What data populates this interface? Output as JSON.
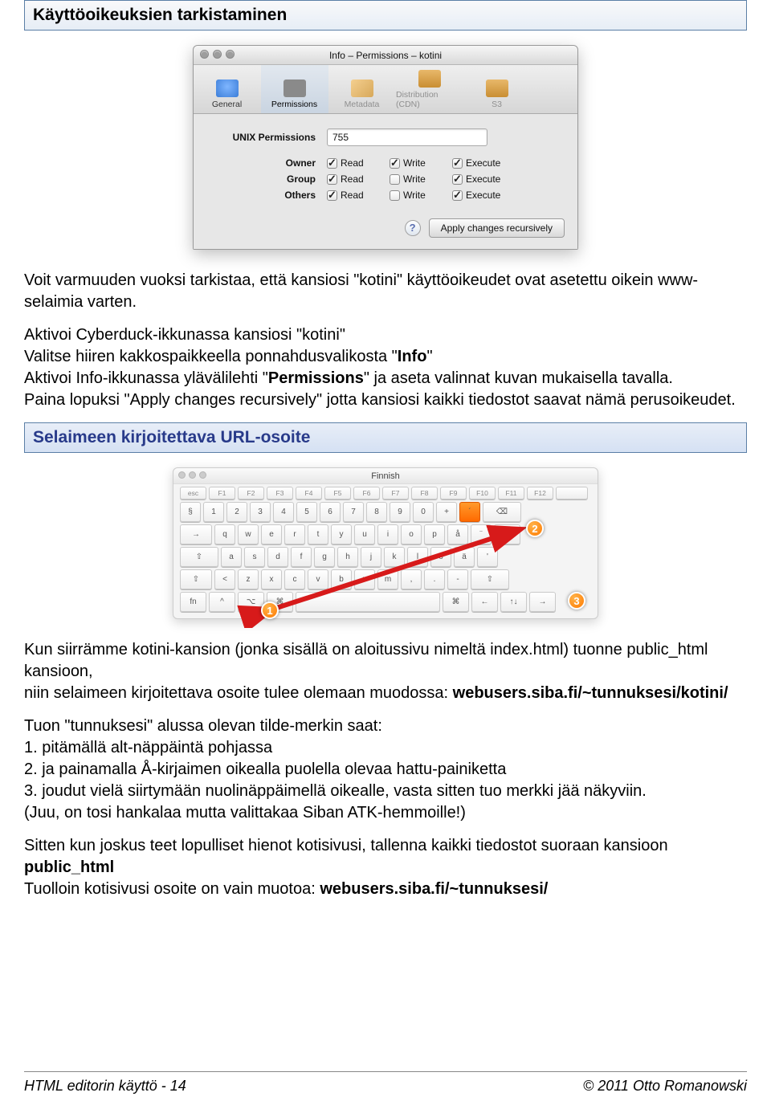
{
  "sections": {
    "permissions_check": "Käyttöoikeuksien tarkistaminen",
    "url_section": "Selaimeen kirjoitettava URL-osoite"
  },
  "mac_dialog": {
    "title": "Info – Permissions – kotini",
    "tabs": {
      "general": "General",
      "permissions": "Permissions",
      "metadata": "Metadata",
      "distribution": "Distribution (CDN)",
      "s3": "S3"
    },
    "unix_perms_label": "UNIX Permissions",
    "unix_perms_value": "755",
    "rows": {
      "owner": "Owner",
      "group": "Group",
      "others": "Others"
    },
    "cols": {
      "read": "Read",
      "write": "Write",
      "execute": "Execute"
    },
    "checks": {
      "owner": {
        "read": true,
        "write": true,
        "execute": true
      },
      "group": {
        "read": true,
        "write": false,
        "execute": true
      },
      "others": {
        "read": true,
        "write": false,
        "execute": true
      }
    },
    "help": "?",
    "apply": "Apply changes recursively"
  },
  "para_after_dialog": {
    "p1": "Voit varmuuden vuoksi tarkistaa, että kansiosi \"kotini\" käyttöoikeudet ovat asetettu oikein www-selaimia varten.",
    "p2a": "Aktivoi Cyberduck-ikkunassa kansiosi \"kotini\"",
    "p2b": "Valitse hiiren kakkospaikkeella ponnahdusvalikosta \"",
    "p2b_bold": "Info",
    "p2b_end": "\"",
    "p2c": "Aktivoi Info-ikkunassa ylävälilehti \"",
    "p2c_bold": "Permissions",
    "p2c_end": "\" ja aseta valinnat kuvan mukaisella tavalla.",
    "p2d": "Paina lopuksi \"Apply changes recursively\" jotta kansiosi kaikki tiedostot saavat nämä perusoikeudet."
  },
  "keyboard": {
    "title": "Finnish",
    "fn_row": [
      "esc",
      "F1",
      "F2",
      "F3",
      "F4",
      "F5",
      "F6",
      "F7",
      "F8",
      "F9",
      "F10",
      "F11",
      "F12",
      ""
    ],
    "row1": [
      "§",
      "1",
      "2",
      "3",
      "4",
      "5",
      "6",
      "7",
      "8",
      "9",
      "0",
      "+",
      "´",
      "⌫"
    ],
    "row2": [
      "→",
      "q",
      "w",
      "e",
      "r",
      "t",
      "y",
      "u",
      "i",
      "o",
      "p",
      "å",
      "¨",
      "↵"
    ],
    "row3": [
      "⇧",
      "a",
      "s",
      "d",
      "f",
      "g",
      "h",
      "j",
      "k",
      "l",
      "ö",
      "ä",
      "'"
    ],
    "row4": [
      "⇧",
      "<",
      "z",
      "x",
      "c",
      "v",
      "b",
      "n",
      "m",
      ",",
      ".",
      "-",
      "⇧"
    ],
    "row5": [
      "fn",
      "^",
      "⌥",
      "⌘",
      "",
      "⌘",
      "←",
      "↑↓",
      "→"
    ],
    "markers": {
      "m1": "1",
      "m2": "2",
      "m3": "3"
    }
  },
  "para_after_kbd": {
    "p1a": "Kun siirrämme kotini-kansion (jonka sisällä on aloitussivu nimeltä index.html) tuonne public_html kansioon,",
    "p1b": "niin selaimeen kirjoitettava osoite tulee olemaan muodossa: ",
    "p1b_bold": "webusers.siba.fi/~tunnuksesi/kotini/",
    "p2": "Tuon \"tunnuksesi\" alussa olevan tilde-merkin saat:",
    "li1": "1. pitämällä alt-näppäintä pohjassa",
    "li2": "2. ja painamalla Å-kirjaimen oikealla puolella olevaa hattu-painiketta",
    "li3": "3. joudut vielä siirtymään nuolinäppäimellä oikealle, vasta sitten tuo merkki jää näkyviin.",
    "note": "(Juu, on tosi hankalaa mutta valittakaa Siban ATK-hemmoille!)",
    "p3a": "Sitten kun joskus teet lopulliset hienot kotisivusi, tallenna kaikki tiedostot suoraan kansioon ",
    "p3a_bold": "public_html",
    "p3b": "Tuolloin kotisivusi osoite on vain muotoa: ",
    "p3b_bold": "webusers.siba.fi/~tunnuksesi/"
  },
  "footer": {
    "left": "HTML editorin käyttö - 14",
    "right": "© 2011 Otto Romanowski"
  }
}
